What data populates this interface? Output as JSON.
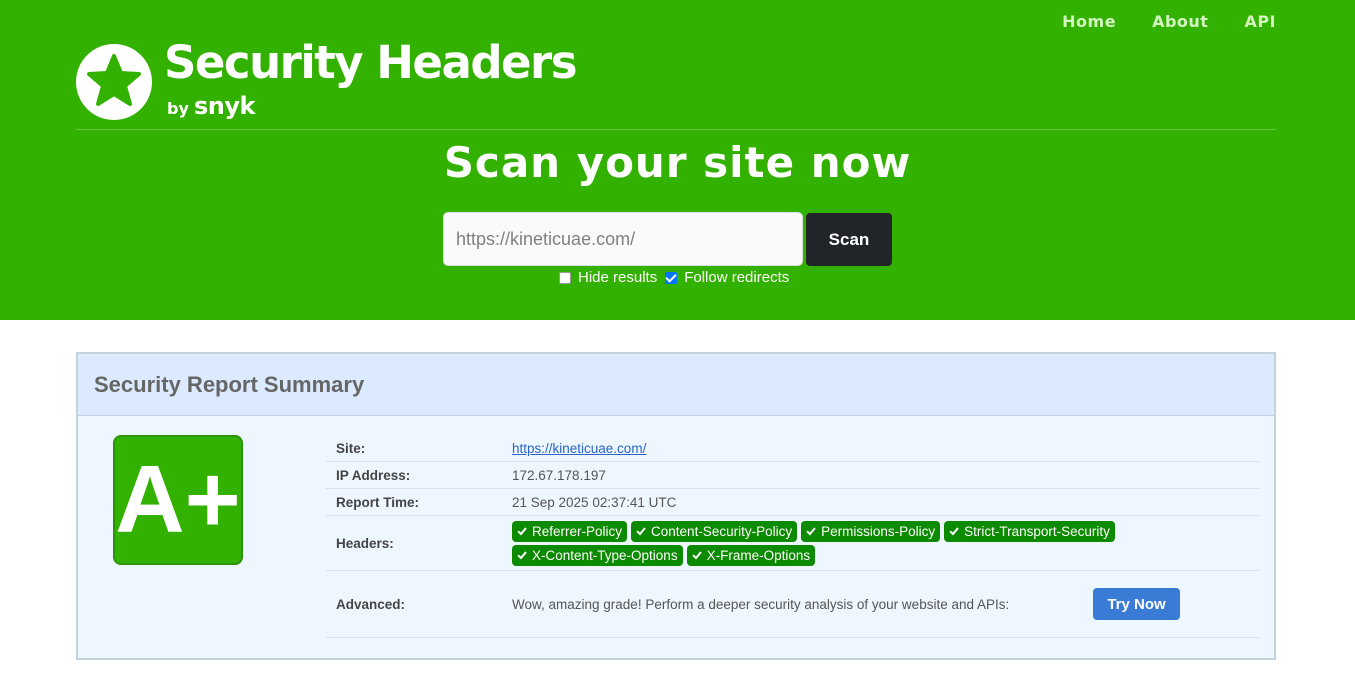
{
  "header": {
    "brand": {
      "title": "Security Headers",
      "by": "by",
      "company": "snyk",
      "logo_icon": "star-icon"
    },
    "nav": [
      {
        "label": "Home"
      },
      {
        "label": "About"
      },
      {
        "label": "API"
      }
    ],
    "scan": {
      "title": "Scan your site now",
      "input_placeholder": "https://kineticuae.com/",
      "button_label": "Scan",
      "hide_results_label": "Hide results",
      "hide_results_checked": false,
      "follow_redirects_label": "Follow redirects",
      "follow_redirects_checked": true
    },
    "colors": {
      "background": "#33b100",
      "button": "#212529"
    }
  },
  "report": {
    "title": "Security Report Summary",
    "grade": "A+",
    "grade_color": "#33b100",
    "rows": {
      "site": {
        "label": "Site:",
        "value": "https://kineticuae.com/"
      },
      "ip": {
        "label": "IP Address:",
        "value": "172.67.178.197"
      },
      "time": {
        "label": "Report Time:",
        "value": "21 Sep 2025 02:37:41 UTC"
      },
      "headers": {
        "label": "Headers:",
        "badges": [
          "Referrer-Policy",
          "Content-Security-Policy",
          "Permissions-Policy",
          "Strict-Transport-Security",
          "X-Content-Type-Options",
          "X-Frame-Options"
        ],
        "badge_icon": "check-icon",
        "badge_color": "#0c8a00"
      },
      "advanced": {
        "label": "Advanced:",
        "text": "Wow, amazing grade! Perform a deeper security analysis of your website and APIs:",
        "button_label": "Try Now",
        "button_color": "#3a7bd5"
      }
    }
  }
}
